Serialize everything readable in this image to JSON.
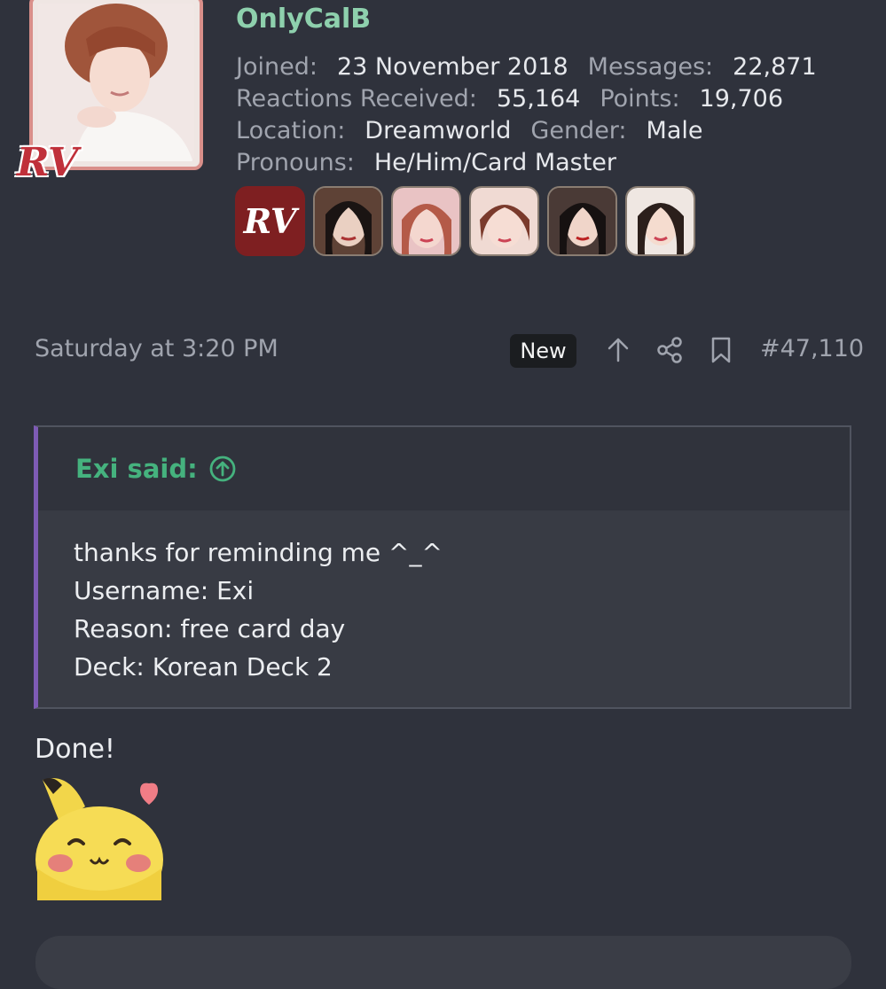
{
  "profile": {
    "username": "OnlyCalB",
    "stats": [
      [
        {
          "label": "Joined:",
          "value": "23 November 2018"
        },
        {
          "label": "Messages:",
          "value": "22,871"
        }
      ],
      [
        {
          "label": "Reactions Received:",
          "value": "55,164"
        },
        {
          "label": "Points:",
          "value": "19,706"
        }
      ],
      [
        {
          "label": "Location:",
          "value": "Dreamworld"
        },
        {
          "label": "Gender:",
          "value": "Male"
        }
      ],
      [
        {
          "label": "Pronouns:",
          "value": "He/Him/Card Master"
        }
      ]
    ],
    "avatar_stamp": "RV",
    "badge_logo": "RV"
  },
  "post": {
    "timestamp": "Saturday at 3:20 PM",
    "new_label": "New",
    "post_number": "#47,110",
    "icons": [
      "arrow-up-icon",
      "share-icon",
      "bookmark-icon"
    ]
  },
  "quote": {
    "author": "Exi said:",
    "lines": [
      "thanks for reminding me ^_^",
      "Username: Exi",
      "Reason: free card day",
      "Deck: Korean Deck 2"
    ]
  },
  "reply": {
    "text": "Done!"
  },
  "colors": {
    "background": "#2f323c",
    "username": "#8ed0ad",
    "quote_author": "#45b27e",
    "quote_bar": "#7e5bb5",
    "avatar_border": "#d98f8a"
  }
}
